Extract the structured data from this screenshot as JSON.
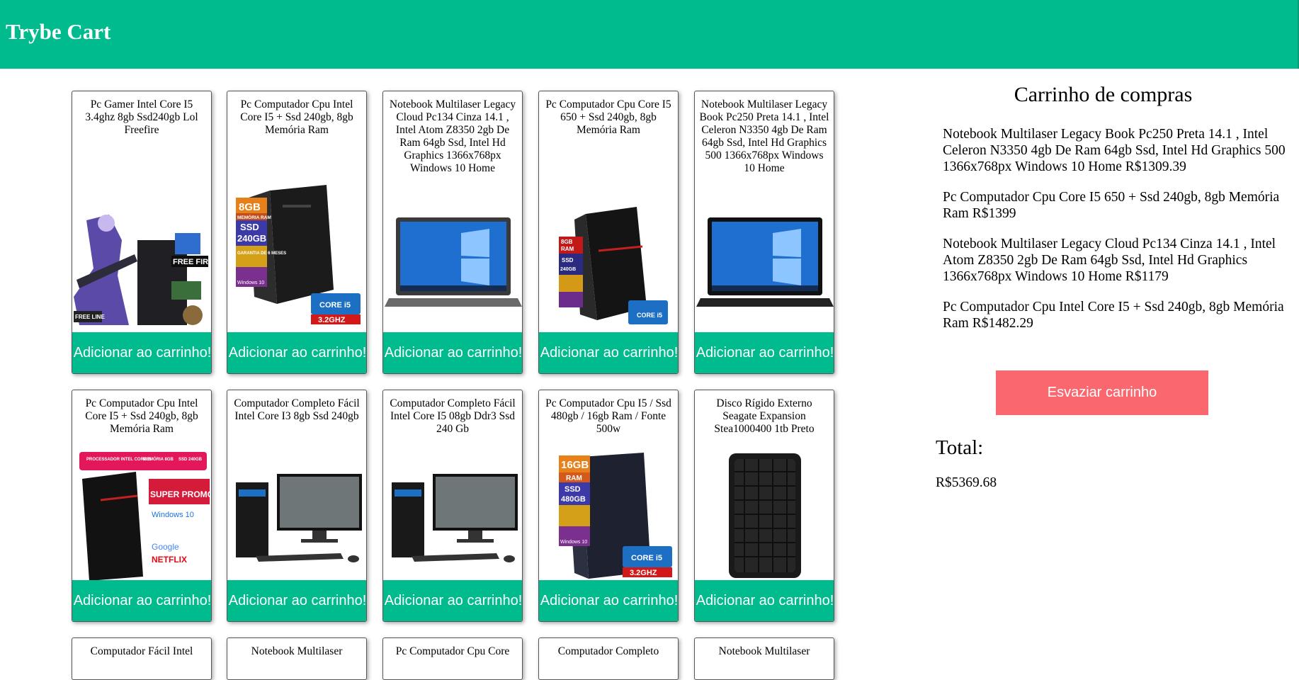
{
  "header": {
    "title": "Trybe Cart"
  },
  "products": [
    {
      "title": "Pc Gamer Intel Core I5 3.4ghz 8gb Ssd240gb Lol Freefire",
      "button": "Adicionar ao carrinho!",
      "image": "pc-gamer-freefire-image"
    },
    {
      "title": "Pc Computador Cpu Intel Core I5 + Ssd 240gb, 8gb Memória Ram",
      "button": "Adicionar ao carrinho!",
      "image": "pc-tower-i5-image",
      "badges": [
        "8GB",
        "MEMÓRIA RAM",
        "SSD",
        "240GB",
        "GARANTIA DE 6 MESES",
        "Windows 10",
        "CORE i5",
        "3.2GHZ"
      ]
    },
    {
      "title": "Notebook Multilaser Legacy Cloud Pc134 Cinza 14.1 , Intel Atom Z8350 2gb De Ram 64gb Ssd, Intel Hd Graphics 1366x768px Windows 10 Home",
      "button": "Adicionar ao carrinho!",
      "image": "notebook-gray-image"
    },
    {
      "title": "Pc Computador Cpu Core I5 650 + Ssd 240gb, 8gb Memória Ram",
      "button": "Adicionar ao carrinho!",
      "image": "pc-tower-red-stripe-image",
      "badges": [
        "8GB",
        "RAM",
        "SSD",
        "240GB",
        "CORE i5"
      ]
    },
    {
      "title": "Notebook Multilaser Legacy Book Pc250 Preta 14.1 , Intel Celeron N3350 4gb De Ram 64gb Ssd, Intel Hd Graphics 500 1366x768px Windows 10 Home",
      "button": "Adicionar ao carrinho!",
      "image": "notebook-black-image"
    },
    {
      "title": "Pc Computador Cpu Intel Core I5 + Ssd 240gb, 8gb Memória Ram",
      "button": "Adicionar ao carrinho!",
      "image": "pc-super-promocao-image",
      "badges": [
        "PROCESSADOR INTEL CORE I5",
        "MEMÓRIA 8GB",
        "SSD 240GB",
        "SUPER PROMOÇÃO",
        "Windows 10",
        "Google",
        "NETFLIX"
      ]
    },
    {
      "title": "Computador Completo Fácil Intel Core I3 8gb Ssd 240gb",
      "button": "Adicionar ao carrinho!",
      "image": "desktop-monitor-i3-image"
    },
    {
      "title": "Computador Completo Fácil Intel Core I5 08gb Ddr3 Ssd 240 Gb",
      "button": "Adicionar ao carrinho!",
      "image": "desktop-monitor-i5-image"
    },
    {
      "title": "Pc Computador Cpu I5 / Ssd 480gb / 16gb Ram / Fonte 500w",
      "button": "Adicionar ao carrinho!",
      "image": "pc-tower-16gb-image",
      "badges": [
        "16GB",
        "RAM",
        "SSD",
        "480GB",
        "Windows 10",
        "CORE i5",
        "3.2GHZ"
      ]
    },
    {
      "title": "Disco Rígido Externo Seagate Expansion Stea1000400 1tb Preto",
      "button": "Adicionar ao carrinho!",
      "image": "external-hdd-image"
    }
  ],
  "partial_row": [
    "Computador Fácil Intel",
    "Notebook Multilaser",
    "Pc Computador Cpu Core",
    "Computador Completo",
    "Notebook Multilaser"
  ],
  "cart": {
    "title": "Carrinho de compras",
    "items": [
      "Notebook Multilaser Legacy Book Pc250 Preta 14.1 , Intel Celeron N3350 4gb De Ram 64gb Ssd, Intel Hd Graphics 500 1366x768px Windows 10 Home R$1309.39",
      "Pc Computador Cpu Core I5 650 + Ssd 240gb, 8gb Memória Ram R$1399",
      "Notebook Multilaser Legacy Cloud Pc134 Cinza 14.1 , Intel Atom Z8350 2gb De Ram 64gb Ssd, Intel Hd Graphics 1366x768px Windows 10 Home R$1179",
      "Pc Computador Cpu Intel Core I5 + Ssd 240gb, 8gb Memória Ram R$1482.29"
    ],
    "empty_button": "Esvaziar carrinho",
    "total_label": "Total:",
    "total_value": "R$5369.68"
  },
  "colors": {
    "header": "#00bb8e",
    "add_button": "#00bb8e",
    "empty_button": "#fa676e"
  }
}
